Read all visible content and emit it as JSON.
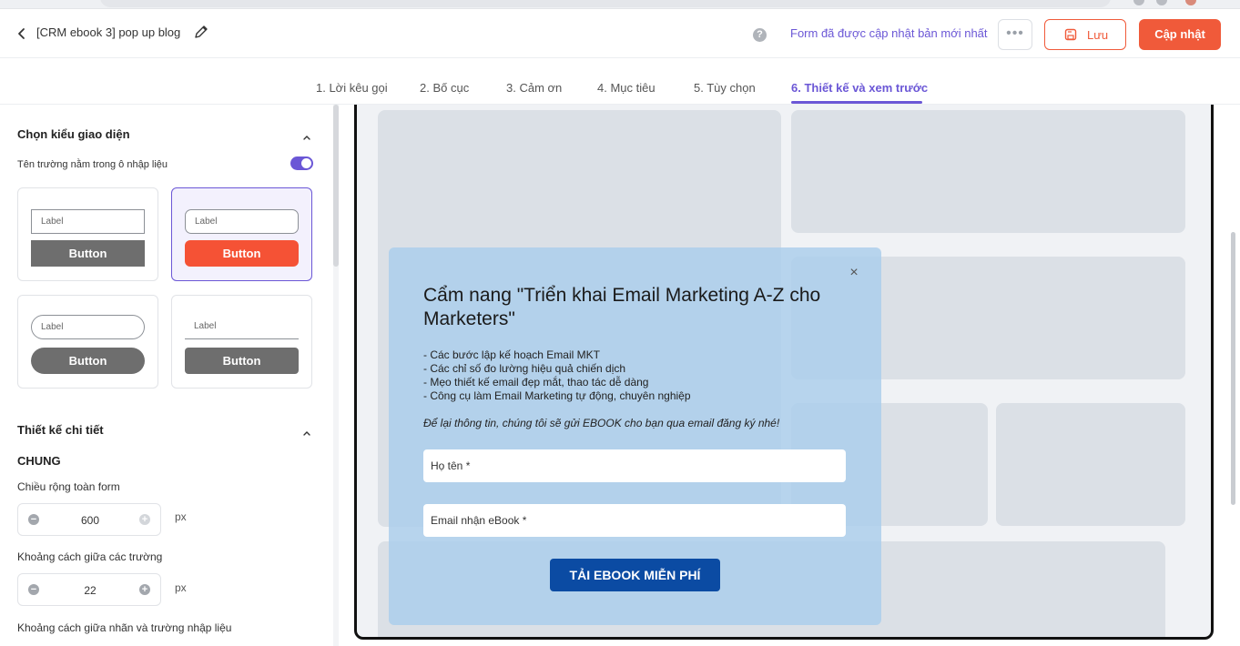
{
  "header": {
    "back_icon": "chevron-left-icon",
    "form_name": "[CRM ebook 3] pop up blog",
    "edit_icon": "pencil-icon",
    "help_icon": "question-circle-icon",
    "help_glyph": "?",
    "update_status": "Form đã được cập nhật bản mới nhất",
    "more_label": "•••",
    "save_label": "Lưu",
    "update_label": "Cập nhật",
    "accent": "#6b57d6",
    "brand": "#f05a3a"
  },
  "tabs": [
    {
      "label": "1. Lời kêu gọi"
    },
    {
      "label": "2. Bố cục"
    },
    {
      "label": "3. Cảm ơn"
    },
    {
      "label": "4. Mục tiêu"
    },
    {
      "label": "5. Tùy chọn"
    },
    {
      "label": "6. Thiết kế và xem trước",
      "active": true
    }
  ],
  "sidebar": {
    "theme_section": "Chọn kiểu giao diện",
    "toggle_label": "Tên trường nằm trong ô nhập liệu",
    "toggle_on": true,
    "styles": [
      {
        "input": "Label",
        "button": "Button"
      },
      {
        "input": "Label",
        "button": "Button",
        "selected": true
      },
      {
        "input": "Label",
        "button": "Button"
      },
      {
        "input": "Label",
        "button": "Button"
      }
    ],
    "detail_section": "Thiết kế chi tiết",
    "general": "CHUNG",
    "form_width_label": "Chiều rộng toàn form",
    "form_width_value": "600",
    "field_gap_label": "Khoảng cách giữa các trường",
    "field_gap_value": "22",
    "label_gap_label": "Khoảng cách giữa nhãn và trường nhập liệu",
    "unit": "px",
    "minus": "−",
    "plus": "+"
  },
  "popup": {
    "close_label": "×",
    "title": "Cẩm nang \"Triển khai Email Marketing A-Z cho Marketers\"",
    "bullets": [
      "- Các bước lập kế hoạch Email MKT",
      "- Các chỉ số đo lường hiệu quả chiến dịch",
      "- Mẹo thiết kế email đẹp mắt, thao tác dễ dàng",
      "- Công cụ làm Email Marketing tự động, chuyên nghiệp"
    ],
    "note": "Để lại thông tin, chúng tôi sẽ gửi EBOOK cho bạn qua email đăng ký nhé!",
    "name_placeholder": "Họ tên *",
    "email_placeholder": "Email nhận eBook *",
    "cta": "TẢI EBOOK MIỄN PHÍ",
    "cta_color": "#0b4ba3"
  }
}
